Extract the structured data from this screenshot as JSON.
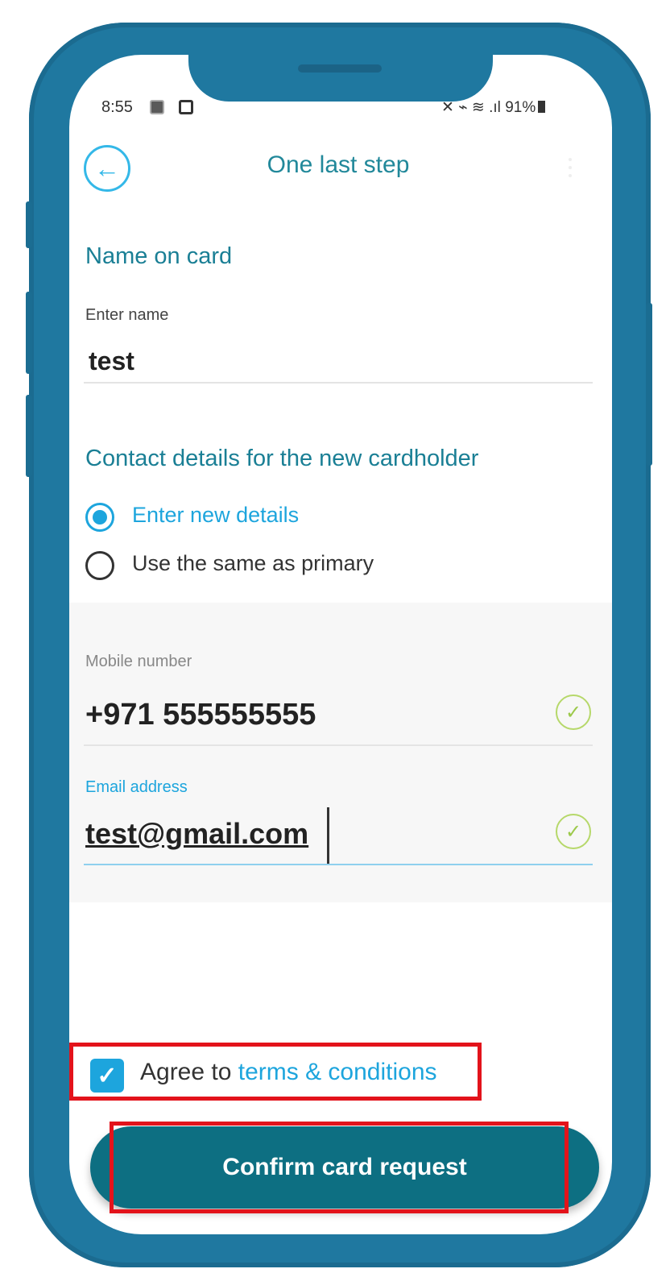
{
  "status_bar": {
    "time": "8:55",
    "right_text": "91%"
  },
  "header": {
    "title": "One last step"
  },
  "name_section": {
    "title": "Name on card",
    "label": "Enter name",
    "value": "test"
  },
  "contact_section": {
    "title": "Contact details for the new cardholder",
    "options": [
      "Enter new details",
      "Use the same as primary"
    ],
    "selected_index": 0
  },
  "mobile": {
    "label": "Mobile number",
    "value": "+971 555555555"
  },
  "email": {
    "label": "Email address",
    "value": "test@gmail.com"
  },
  "terms": {
    "prefix": "Agree to ",
    "link": "terms & conditions",
    "checked": true
  },
  "confirm": {
    "label": "Confirm card request"
  },
  "colors": {
    "frame": "#1f78a0",
    "accent": "#1da5dd",
    "title_teal": "#1a7f95",
    "button": "#0d6f82",
    "highlight": "#e3131b",
    "valid": "#b6d86a"
  }
}
